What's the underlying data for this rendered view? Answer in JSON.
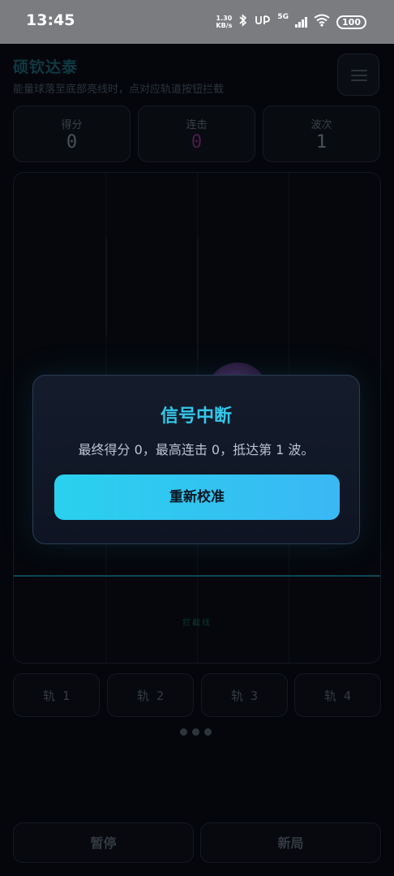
{
  "status_bar": {
    "time": "13:45",
    "net_speed_value": "1.30",
    "net_speed_unit": "KB/s",
    "network_type": "5G",
    "battery": "100",
    "icons": [
      "bluetooth-icon",
      "hd-voice-icon",
      "signal-icon",
      "wifi-icon",
      "battery-icon"
    ]
  },
  "header": {
    "title": "硕钦达泰",
    "subtitle": "能量球落至底部亮线时，点对应轨道按钮拦截",
    "menu_icon": "menu-icon"
  },
  "stats": [
    {
      "label": "得分",
      "value": "0"
    },
    {
      "label": "连击",
      "value": "0"
    },
    {
      "label": "波次",
      "value": "1"
    }
  ],
  "field": {
    "intercept_label": "拦截线",
    "lanes": 4
  },
  "lane_buttons": [
    "轨 1",
    "轨 2",
    "轨 3",
    "轨 4"
  ],
  "bottom_buttons": {
    "pause": "暂停",
    "new_game": "新局"
  },
  "modal": {
    "title": "信号中断",
    "message": "最终得分 0，最高连击 0，抵达第 1 波。",
    "button": "重新校准"
  },
  "colors": {
    "accent": "#33c8ea",
    "button_gradient_start": "#2ad1ee",
    "button_gradient_end": "#3ab8f4",
    "background": "#04060b"
  }
}
